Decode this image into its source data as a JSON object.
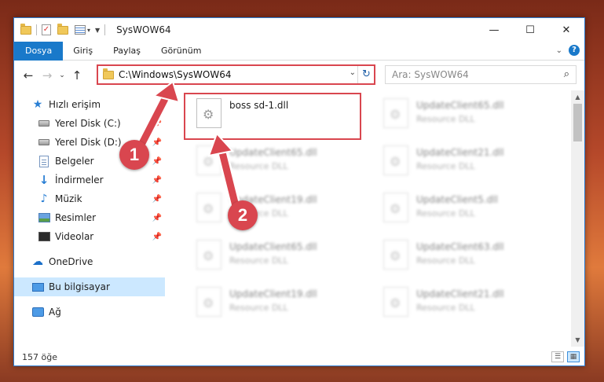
{
  "window": {
    "title": "SysWOW64"
  },
  "ribbon": {
    "tabs": [
      "Dosya",
      "Giriş",
      "Paylaş",
      "Görünüm"
    ]
  },
  "navbar": {
    "address": "C:\\Windows\\SysWOW64",
    "search_placeholder": "Ara: SysWOW64"
  },
  "sidebar": {
    "items": [
      {
        "label": "Hızlı erişim",
        "icon": "star-icon"
      },
      {
        "label": "Yerel Disk (C:)",
        "icon": "disk-icon",
        "pinned": true
      },
      {
        "label": "Yerel Disk (D:)",
        "icon": "disk-icon",
        "pinned": true
      },
      {
        "label": "Belgeler",
        "icon": "documents-icon",
        "pinned": true
      },
      {
        "label": "İndirmeler",
        "icon": "download-icon",
        "pinned": true
      },
      {
        "label": "Müzik",
        "icon": "music-icon",
        "pinned": true
      },
      {
        "label": "Resimler",
        "icon": "pictures-icon",
        "pinned": true
      },
      {
        "label": "Videolar",
        "icon": "videos-icon",
        "pinned": true
      },
      {
        "label": "OneDrive",
        "icon": "cloud-icon"
      },
      {
        "label": "Bu bilgisayar",
        "icon": "computer-icon",
        "selected": true
      },
      {
        "label": "Ağ",
        "icon": "network-icon"
      }
    ]
  },
  "files": {
    "highlighted": {
      "name": "boss sd-1.dll",
      "type": ""
    },
    "others": [
      {
        "name": "UpdateClient65.dll",
        "type": "Resource DLL"
      },
      {
        "name": "UpdateClient65.dll",
        "type": "Resource DLL"
      },
      {
        "name": "UpdateClient21.dll",
        "type": "Resource DLL"
      },
      {
        "name": "UpdateClient19.dll",
        "type": "Resource DLL"
      },
      {
        "name": "UpdateClient5.dll",
        "type": "Resource DLL"
      },
      {
        "name": "UpdateClient65.dll",
        "type": "Resource DLL"
      },
      {
        "name": "UpdateClient63.dll",
        "type": "Resource DLL"
      },
      {
        "name": "UpdateClient19.dll",
        "type": "Resource DLL"
      },
      {
        "name": "UpdateClient21.dll",
        "type": "Resource DLL"
      }
    ]
  },
  "status": {
    "count": "157 öğe"
  },
  "annotations": {
    "badge1": "1",
    "badge2": "2",
    "color": "#d9464f"
  }
}
